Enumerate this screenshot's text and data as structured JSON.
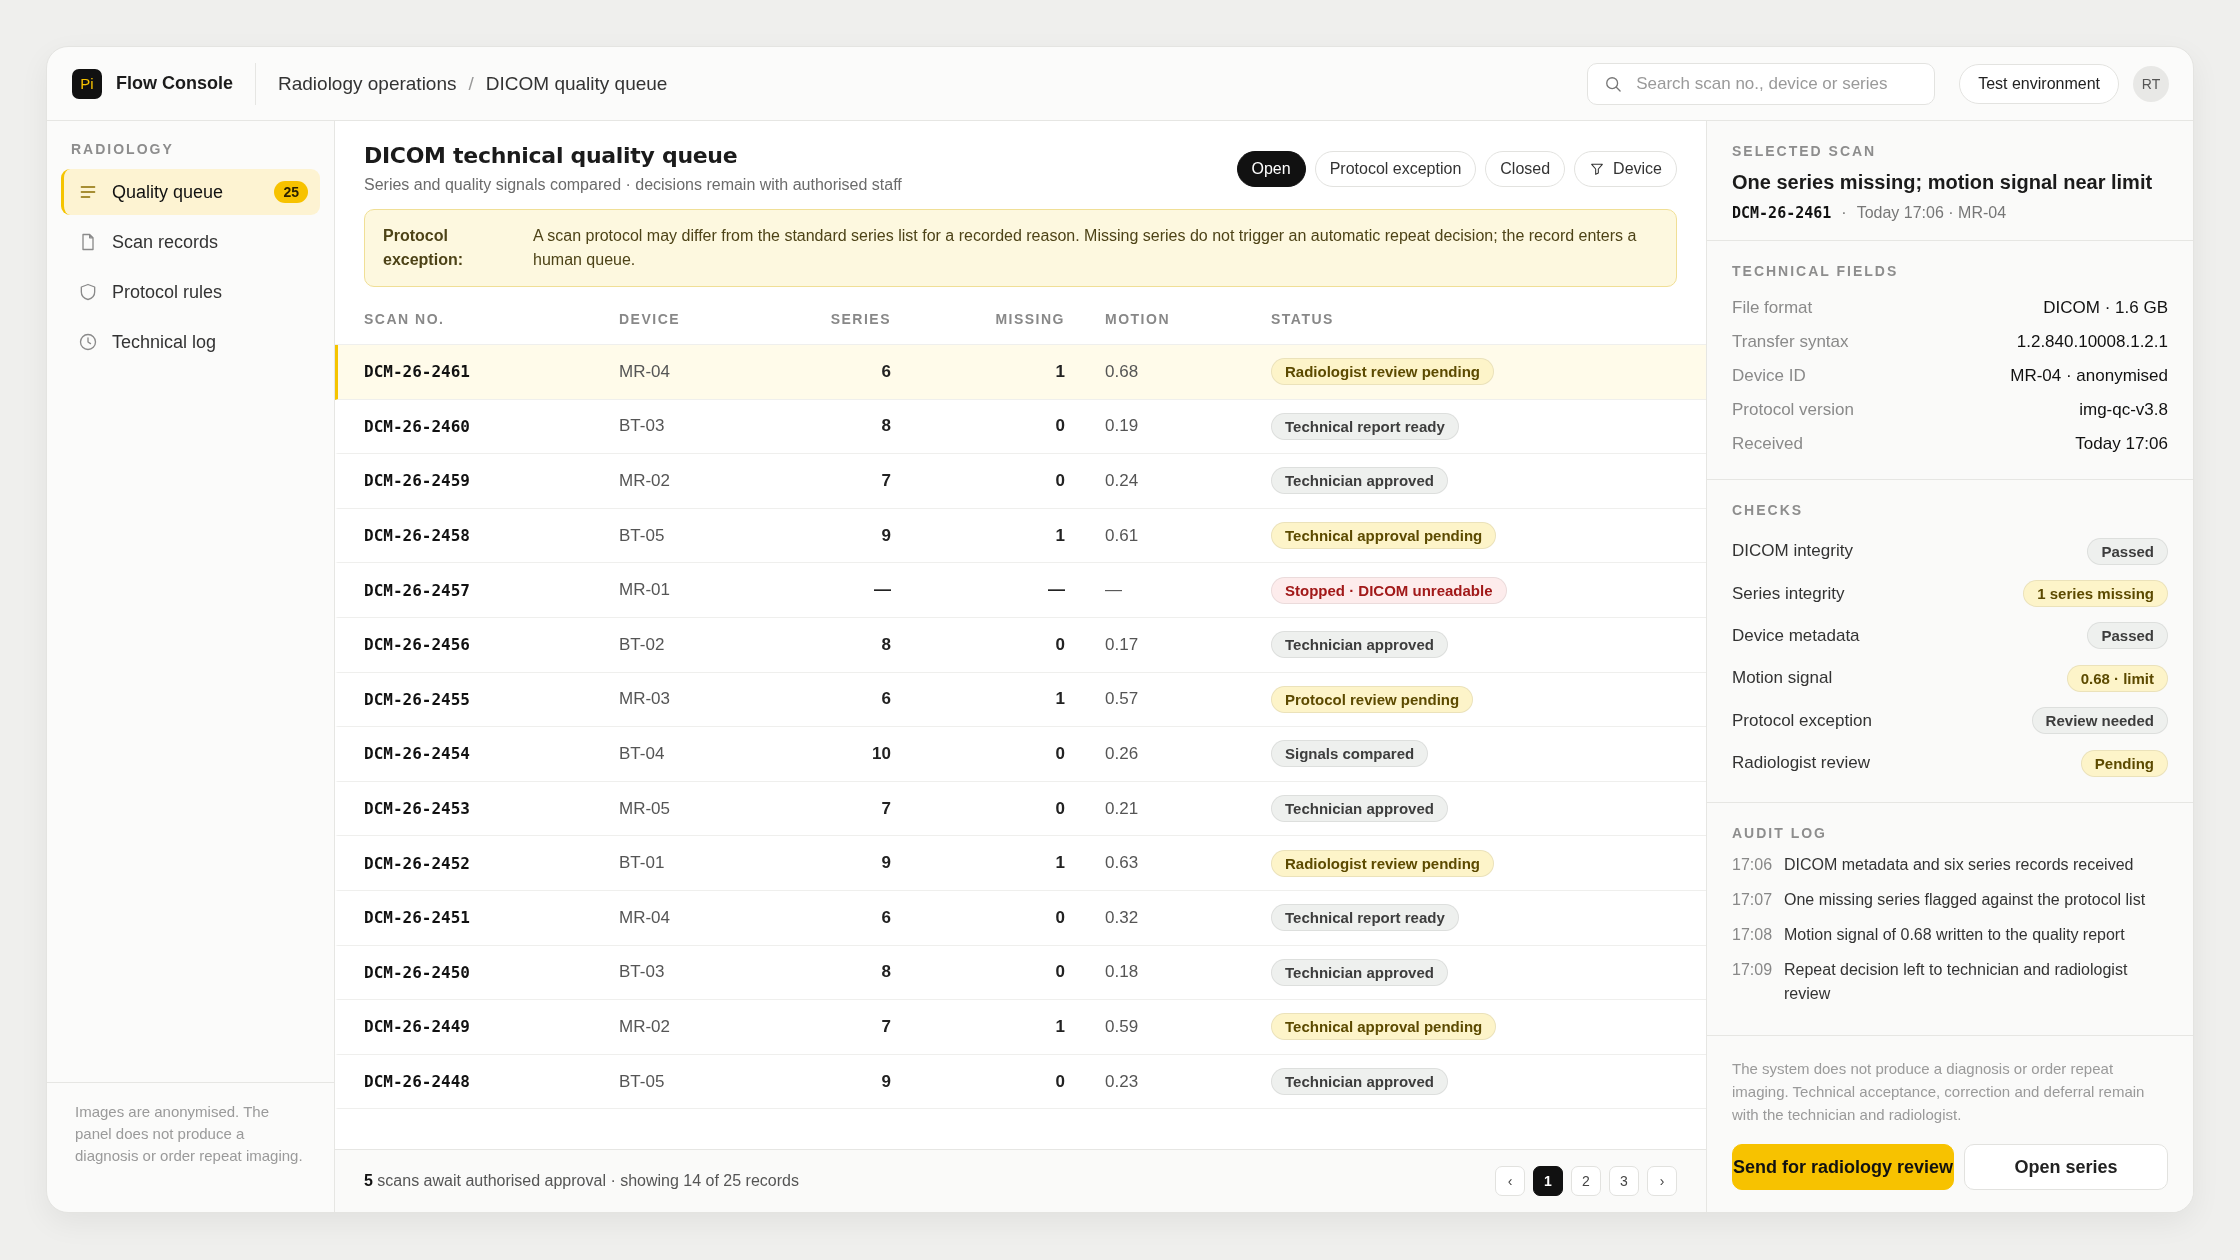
{
  "brand": {
    "logo": "Pi",
    "name": "Flow Console"
  },
  "breadcrumb": {
    "items": [
      "Radiology operations",
      "DICOM quality queue"
    ],
    "separator": "/"
  },
  "search": {
    "placeholder": "Search scan no., device or series"
  },
  "environment": "Test environment",
  "user": {
    "initials": "RT"
  },
  "sidebar": {
    "heading": "RADIOLOGY",
    "items": [
      {
        "label": "Quality queue",
        "badge": "25",
        "selected": true
      },
      {
        "label": "Scan records",
        "selected": false
      },
      {
        "label": "Protocol rules",
        "selected": false
      },
      {
        "label": "Technical log",
        "selected": false
      }
    ],
    "note": "Images are anonymised. The panel does not produce a diagnosis or order repeat imaging."
  },
  "queue": {
    "title": "DICOM technical quality queue",
    "subtitle": "Series and quality signals compared · decisions remain with authorised staff",
    "filters": [
      {
        "label": "Open",
        "kind": "toggle",
        "selected": true
      },
      {
        "label": "Protocol exception",
        "kind": "toggle",
        "selected": false
      },
      {
        "label": "Closed",
        "kind": "toggle",
        "selected": false
      },
      {
        "label": "Device",
        "kind": "filter",
        "selected": false
      }
    ],
    "notice": {
      "label": "Protocol exception:",
      "text": "A scan protocol may differ from the standard series list for a recorded reason. Missing series do not trigger an automatic repeat decision; the record enters a human queue."
    },
    "table": {
      "columns": [
        "SCAN NO.",
        "DEVICE",
        "SERIES",
        "MISSING",
        "MOTION",
        "STATUS"
      ],
      "rows": [
        {
          "scan": "DCM-26-2461",
          "device": "MR-04",
          "series": "6",
          "missing": "1",
          "motion": "0.68",
          "status": {
            "label": "Radiologist review pending",
            "color": "#fdf4c9"
          },
          "selected": true
        },
        {
          "scan": "DCM-26-2460",
          "device": "BT-03",
          "series": "8",
          "missing": "0",
          "motion": "0.19",
          "status": {
            "label": "Technical report ready",
            "color": "#eef0ee"
          },
          "selected": false
        },
        {
          "scan": "DCM-26-2459",
          "device": "MR-02",
          "series": "7",
          "missing": "0",
          "motion": "0.24",
          "status": {
            "label": "Technician approved",
            "color": "#eef0ee"
          },
          "selected": false
        },
        {
          "scan": "DCM-26-2458",
          "device": "BT-05",
          "series": "9",
          "missing": "1",
          "motion": "0.61",
          "status": {
            "label": "Technical approval pending",
            "color": "#fdf4c9"
          },
          "selected": false
        },
        {
          "scan": "DCM-26-2457",
          "device": "MR-01",
          "series": "—",
          "missing": "—",
          "motion": "—",
          "status": {
            "label": "Stopped · DICOM unreadable",
            "color": "#fdecec"
          },
          "selected": false
        },
        {
          "scan": "DCM-26-2456",
          "device": "BT-02",
          "series": "8",
          "missing": "0",
          "motion": "0.17",
          "status": {
            "label": "Technician approved",
            "color": "#eef0ee"
          },
          "selected": false
        },
        {
          "scan": "DCM-26-2455",
          "device": "MR-03",
          "series": "6",
          "missing": "1",
          "motion": "0.57",
          "status": {
            "label": "Protocol review pending",
            "color": "#fdf4c9"
          },
          "selected": false
        },
        {
          "scan": "DCM-26-2454",
          "device": "BT-04",
          "series": "10",
          "missing": "0",
          "motion": "0.26",
          "status": {
            "label": "Signals compared",
            "color": "#eef0ee"
          },
          "selected": false
        },
        {
          "scan": "DCM-26-2453",
          "device": "MR-05",
          "series": "7",
          "missing": "0",
          "motion": "0.21",
          "status": {
            "label": "Technician approved",
            "color": "#eef0ee"
          },
          "selected": false
        },
        {
          "scan": "DCM-26-2452",
          "device": "BT-01",
          "series": "9",
          "missing": "1",
          "motion": "0.63",
          "status": {
            "label": "Radiologist review pending",
            "color": "#fdf4c9"
          },
          "selected": false
        },
        {
          "scan": "DCM-26-2451",
          "device": "MR-04",
          "series": "6",
          "missing": "0",
          "motion": "0.32",
          "status": {
            "label": "Technical report ready",
            "color": "#eef0ee"
          },
          "selected": false
        },
        {
          "scan": "DCM-26-2450",
          "device": "BT-03",
          "series": "8",
          "missing": "0",
          "motion": "0.18",
          "status": {
            "label": "Technician approved",
            "color": "#eef0ee"
          },
          "selected": false
        },
        {
          "scan": "DCM-26-2449",
          "device": "MR-02",
          "series": "7",
          "missing": "1",
          "motion": "0.59",
          "status": {
            "label": "Technical approval pending",
            "color": "#fdf4c9"
          },
          "selected": false
        },
        {
          "scan": "DCM-26-2448",
          "device": "BT-05",
          "series": "9",
          "missing": "0",
          "motion": "0.23",
          "status": {
            "label": "Technician approved",
            "color": "#eef0ee"
          },
          "selected": false
        }
      ]
    },
    "footer": {
      "summary": "**5** scans await authorised approval · showing 14 of 25 records",
      "prev": "‹",
      "next": "›",
      "pages": [
        {
          "label": "1",
          "selected": true
        },
        {
          "label": "2",
          "selected": false
        },
        {
          "label": "3",
          "selected": false
        }
      ]
    }
  },
  "detail": {
    "heading": "SELECTED SCAN",
    "title": "One series missing; motion signal near limit",
    "scan": "DCM-26-2461",
    "separator": "·",
    "meta": "Today 17:06 · MR-04",
    "fields_heading": "TECHNICAL FIELDS",
    "fields": [
      {
        "label": "File format",
        "value": "DICOM · 1.6 GB"
      },
      {
        "label": "Transfer syntax",
        "value": "1.2.840.10008.1.2.1"
      },
      {
        "label": "Device ID",
        "value": "MR-04 · anonymised"
      },
      {
        "label": "Protocol version",
        "value": "img-qc-v3.8"
      },
      {
        "label": "Received",
        "value": "Today 17:06"
      }
    ],
    "checks_heading": "CHECKS",
    "checks": [
      {
        "label": "DICOM integrity",
        "status": "Passed",
        "color": "#eef0ee"
      },
      {
        "label": "Series integrity",
        "status": "1 series missing",
        "color": "#fdf4c9"
      },
      {
        "label": "Device metadata",
        "status": "Passed",
        "color": "#eef0ee"
      },
      {
        "label": "Motion signal",
        "status": "0.68 · limit",
        "color": "#fdf4c9"
      },
      {
        "label": "Protocol exception",
        "status": "Review needed",
        "color": "#eef0ee"
      },
      {
        "label": "Radiologist review",
        "status": "Pending",
        "color": "#fdf4c9"
      }
    ],
    "audit_heading": "AUDIT LOG",
    "audit": [
      {
        "time": "17:06",
        "text": "DICOM metadata and six series records received"
      },
      {
        "time": "17:07",
        "text": "One missing series flagged against the protocol list"
      },
      {
        "time": "17:08",
        "text": "Motion signal of 0.68 written to the quality report"
      },
      {
        "time": "17:09",
        "text": "Repeat decision left to technician and radiologist review"
      }
    ],
    "disclaimer": "The system does not produce a diagnosis or order repeat imaging. Technical acceptance, correction and deferral remain with the technician and radiologist.",
    "actions": [
      {
        "label": "Send for radiology review",
        "kind": "primary"
      },
      {
        "label": "Open series",
        "kind": "secondary"
      }
    ]
  }
}
